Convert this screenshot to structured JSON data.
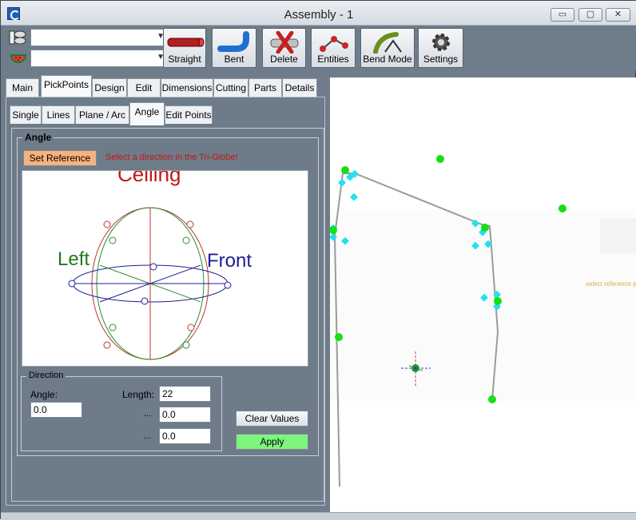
{
  "window": {
    "title": "Assembly - 1",
    "minimize": "▭",
    "maximize": "▢",
    "close": "✕"
  },
  "toolbar": {
    "combo1_value": "",
    "combo2_value": "",
    "buttons": [
      {
        "label": "Straight",
        "icon": "straight-pipe-icon"
      },
      {
        "label": "Bent",
        "icon": "bent-pipe-icon"
      },
      {
        "label": "Delete",
        "icon": "delete-pipe-icon"
      },
      {
        "label": "Entities",
        "icon": "entities-icon"
      },
      {
        "label": "Bend Mode",
        "icon": "bend-mode-icon"
      },
      {
        "label": "Settings",
        "icon": "gear-icon"
      }
    ]
  },
  "main_tabs": [
    "Main",
    "PickPoints",
    "Design",
    "Edit",
    "Dimensions",
    "Cutting",
    "Parts",
    "Details"
  ],
  "main_tab_active": "PickPoints",
  "sub_tabs": [
    "Single",
    "Lines",
    "Plane / Arc",
    "Angle",
    "Edit Points"
  ],
  "sub_tab_active": "Angle",
  "angle_group": {
    "title": "Angle",
    "set_reference_label": "Set Reference",
    "hint": "Select a direction in the Tri-Globe!",
    "globe_labels": {
      "ceiling": "Ceiling",
      "left": "Left",
      "front": "Front"
    }
  },
  "direction": {
    "title": "Direction",
    "angle_label": "Angle:",
    "angle_value": "0.0",
    "length_label": "Length:",
    "length_value": "22",
    "field2_label": "...",
    "field2_value": "0.0",
    "field3_label": "...",
    "field3_value": "0.0"
  },
  "buttons": {
    "clear_values": "Clear Values",
    "apply": "Apply"
  },
  "viewport": {
    "side_hint": "select reference p"
  },
  "colors": {
    "apply_green": "#7ef57e",
    "set_reference": "#f7b27e",
    "hint_red": "#c01818"
  }
}
